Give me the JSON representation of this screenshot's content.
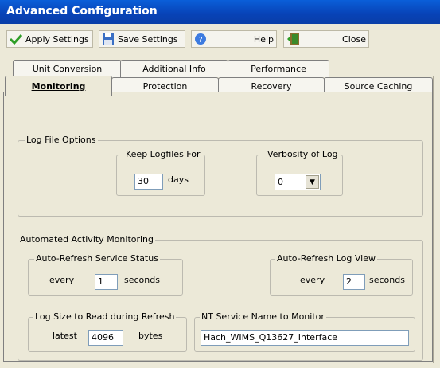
{
  "window": {
    "title": "Advanced Configuration"
  },
  "toolbar": {
    "apply_label": "Apply Settings",
    "save_label": "Save Settings",
    "help_label": "Help",
    "close_label": "Close"
  },
  "tabs_row1": [
    "Unit Conversion",
    "Additional Info",
    "Performance"
  ],
  "tabs_row2": [
    "Monitoring",
    "Protection",
    "Recovery",
    "Source Caching"
  ],
  "active_tab": "Monitoring",
  "log_file_options": {
    "title": "Log File Options",
    "keep": {
      "title": "Keep Logfiles For",
      "value": "30",
      "unit": "days"
    },
    "verbosity": {
      "title": "Verbosity of Log",
      "value": "0"
    }
  },
  "monitoring": {
    "title": "Automated Activity Monitoring",
    "service_status": {
      "title": "Auto-Refresh Service Status",
      "prefix": "every",
      "value": "1",
      "unit": "seconds"
    },
    "log_view": {
      "title": "Auto-Refresh Log View",
      "prefix": "every",
      "value": "2",
      "unit": "seconds"
    },
    "log_size": {
      "title": "Log Size to Read during Refresh",
      "prefix": "latest",
      "value": "4096",
      "unit": "bytes"
    },
    "service_name": {
      "title": "NT Service Name to Monitor",
      "value": "Hach_WIMS_Q13627_Interface"
    }
  }
}
